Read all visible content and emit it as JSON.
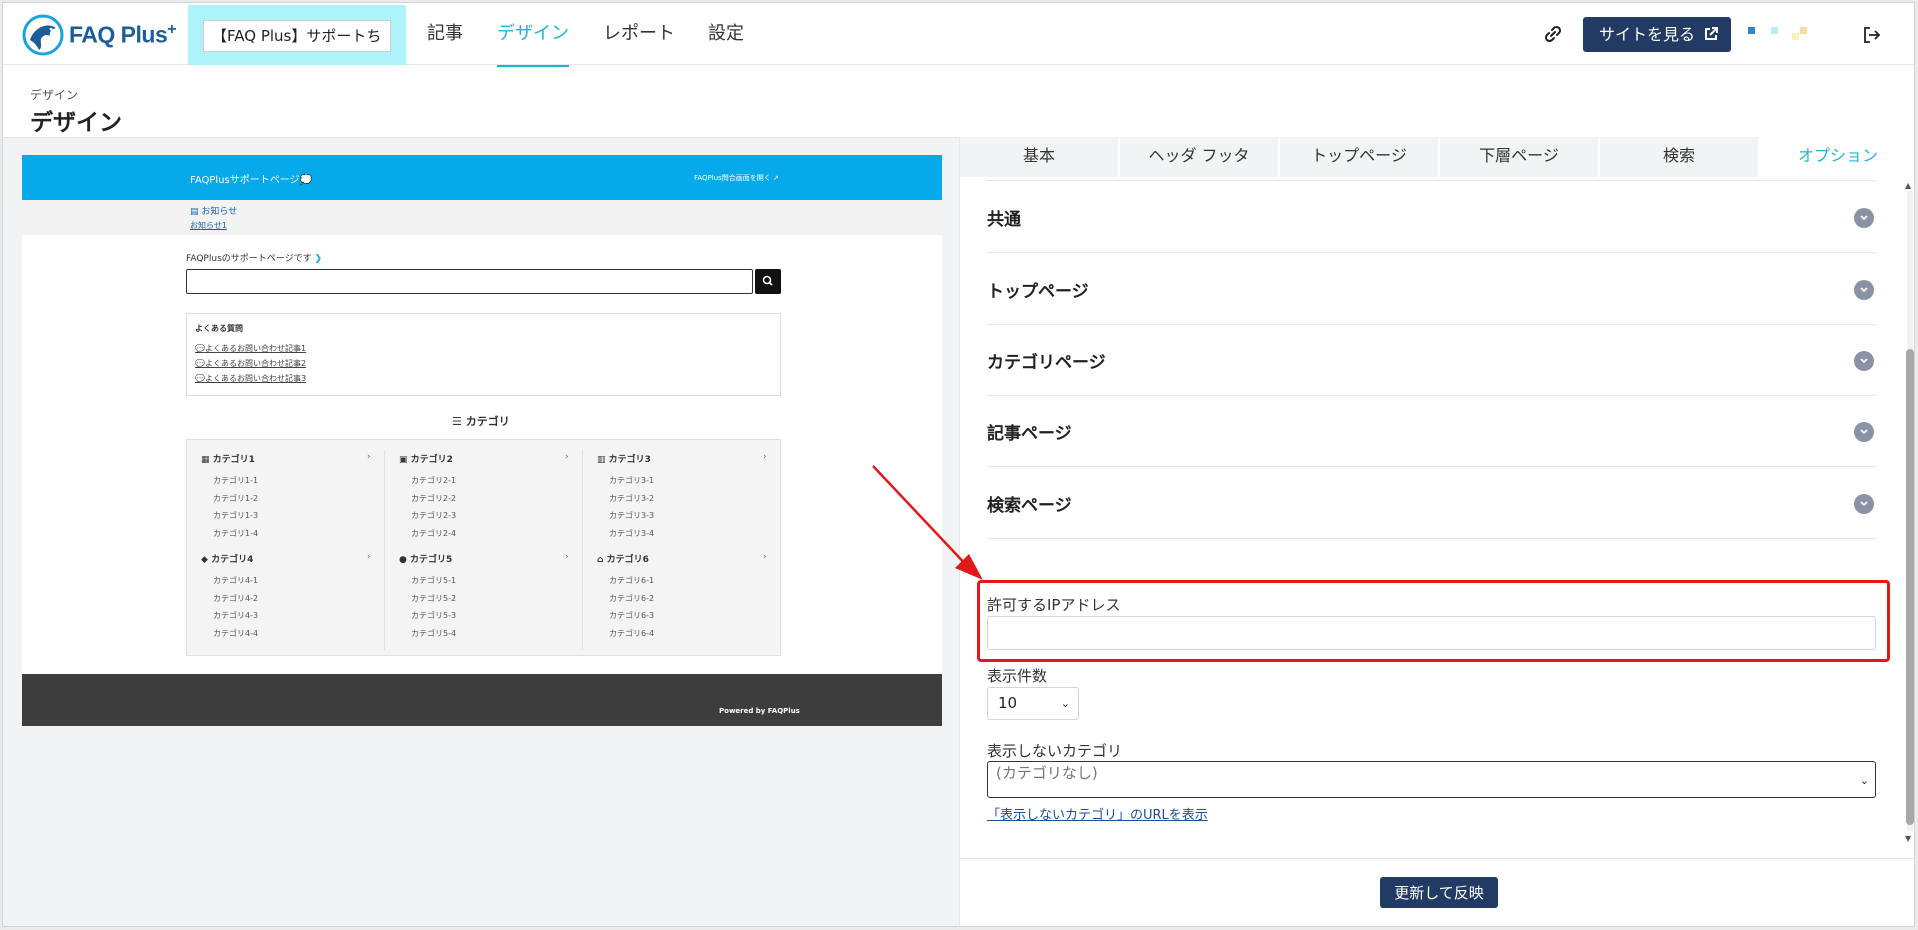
{
  "header": {
    "logo_text": "FAQ Plus",
    "logo_sup": "+",
    "site_selector": "【FAQ Plus】サポートち",
    "nav": [
      {
        "label": "記事",
        "active": false
      },
      {
        "label": "デザイン",
        "active": true
      },
      {
        "label": "レポート",
        "active": false
      },
      {
        "label": "設定",
        "active": false
      }
    ],
    "view_site_label": "サイトを見る",
    "icons": {
      "link": "link-icon",
      "external": "external-link-icon",
      "logout": "logout-icon"
    }
  },
  "page": {
    "breadcrumb": "デザイン",
    "title": "デザイン"
  },
  "preview": {
    "site_title": "FAQPlusサポートページ💭",
    "inquiry_link": "FAQPlus問合画面を開く",
    "news_heading": "お知らせ",
    "news_item": "お知らせ1",
    "intro": "FAQPlusのサポートページです",
    "faq_heading": "よくある質問",
    "faq_items": [
      "よくあるお問い合わせ記事1",
      "よくあるお問い合わせ記事2",
      "よくあるお問い合わせ記事3"
    ],
    "category_heading": "カテゴリ",
    "categories": [
      {
        "name": "カテゴリ1",
        "subs": [
          "カテゴリ1-1",
          "カテゴリ1-2",
          "カテゴリ1-3",
          "カテゴリ1-4"
        ]
      },
      {
        "name": "カテゴリ2",
        "subs": [
          "カテゴリ2-1",
          "カテゴリ2-2",
          "カテゴリ2-3",
          "カテゴリ2-4"
        ]
      },
      {
        "name": "カテゴリ3",
        "subs": [
          "カテゴリ3-1",
          "カテゴリ3-2",
          "カテゴリ3-3",
          "カテゴリ3-4"
        ]
      },
      {
        "name": "カテゴリ4",
        "subs": [
          "カテゴリ4-1",
          "カテゴリ4-2",
          "カテゴリ4-3",
          "カテゴリ4-4"
        ]
      },
      {
        "name": "カテゴリ5",
        "subs": [
          "カテゴリ5-1",
          "カテゴリ5-2",
          "カテゴリ5-3",
          "カテゴリ5-4"
        ]
      },
      {
        "name": "カテゴリ6",
        "subs": [
          "カテゴリ6-1",
          "カテゴリ6-2",
          "カテゴリ6-3",
          "カテゴリ6-4"
        ]
      }
    ],
    "footer_text": "Powered by FAQPlus"
  },
  "panel": {
    "tabs": [
      {
        "label": "基本",
        "active": false
      },
      {
        "label": "ヘッダ フッタ",
        "active": false
      },
      {
        "label": "トップページ",
        "active": false
      },
      {
        "label": "下層ページ",
        "active": false
      },
      {
        "label": "検索",
        "active": false
      },
      {
        "label": "オプション",
        "active": true
      }
    ],
    "sections": [
      "共通",
      "トップページ",
      "カテゴリページ",
      "記事ページ",
      "検索ページ"
    ],
    "ip_label": "許可するIPアドレス",
    "ip_value": "",
    "count_label": "表示件数",
    "count_value": "10",
    "hidden_category_label": "表示しないカテゴリ",
    "hidden_category_value": "(カテゴリなし)",
    "hidden_category_url_link": "「表示しないカテゴリ」のURLを表示",
    "update_button": "更新して反映"
  },
  "colors": {
    "accent": "#1fb4d8",
    "primary_button": "#223b64",
    "preview_header": "#06a9e9",
    "highlight": "#e31818"
  }
}
